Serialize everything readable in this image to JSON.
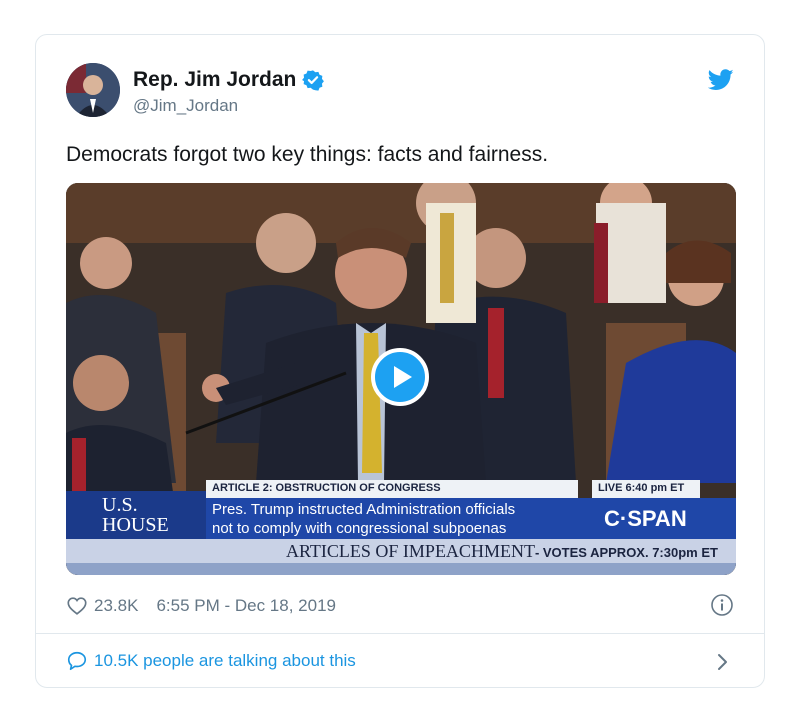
{
  "tweet": {
    "author_name": "Rep. Jim Jordan",
    "handle": "@Jim_Jordan",
    "text": "Democrats forgot two key things: facts and fairness.",
    "likes": "23.8K",
    "timestamp": "6:55 PM - Dec 18, 2019",
    "talking": "10.5K people are talking about this"
  },
  "video": {
    "article": "ARTICLE 2: OBSTRUCTION OF CONGRESS",
    "live": "LIVE  6:40 pm ET",
    "house_line1": "U.S.",
    "house_line2": "HOUSE",
    "caption_line1": "Pres. Trump instructed Administration officials",
    "caption_line2": "not to comply with congressional subpoenas",
    "network": "C·SPAN",
    "bottom_big": "ARTICLES OF IMPEACHMENT",
    "bottom_small": "- VOTES APPROX. 7:30pm ET"
  },
  "colors": {
    "twitter_blue": "#1da1f2",
    "link_blue": "#1b95e0",
    "muted": "#657786",
    "cspan_blue": "#1f47a8"
  },
  "icons": [
    "verified-badge-icon",
    "twitter-bird-icon",
    "play-icon",
    "heart-icon",
    "info-icon",
    "speech-bubble-icon",
    "chevron-right-icon"
  ]
}
